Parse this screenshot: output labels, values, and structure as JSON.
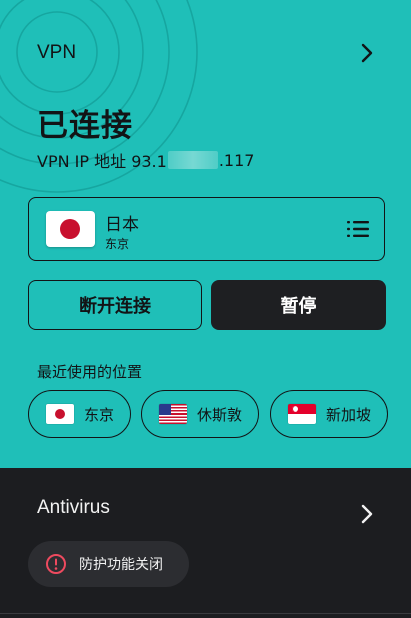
{
  "header": {
    "vpn_label": "VPN",
    "status_title": "已连接",
    "ip_prefix": "VPN IP 地址 93.1",
    "ip_suffix": ".117"
  },
  "current_location": {
    "country": "日本",
    "city": "东京",
    "flag_icon": "japan-flag-icon"
  },
  "buttons": {
    "disconnect_label": "断开连接",
    "pause_label": "暂停"
  },
  "recent": {
    "label": "最近使用的位置",
    "items": [
      {
        "label": "东京",
        "flag_icon": "japan-flag-icon"
      },
      {
        "label": "休斯敦",
        "flag_icon": "usa-flag-icon"
      },
      {
        "label": "新加坡",
        "flag_icon": "singapore-flag-icon"
      }
    ]
  },
  "antivirus": {
    "title": "Antivirus",
    "status_label": "防护功能关闭",
    "status_icon": "info-circle-icon"
  },
  "colors": {
    "vpn_background": "#1fbfb8",
    "dark_background": "#1c1d20",
    "pause_button": "#1e1f22",
    "warning_red": "#ee4a5f"
  }
}
